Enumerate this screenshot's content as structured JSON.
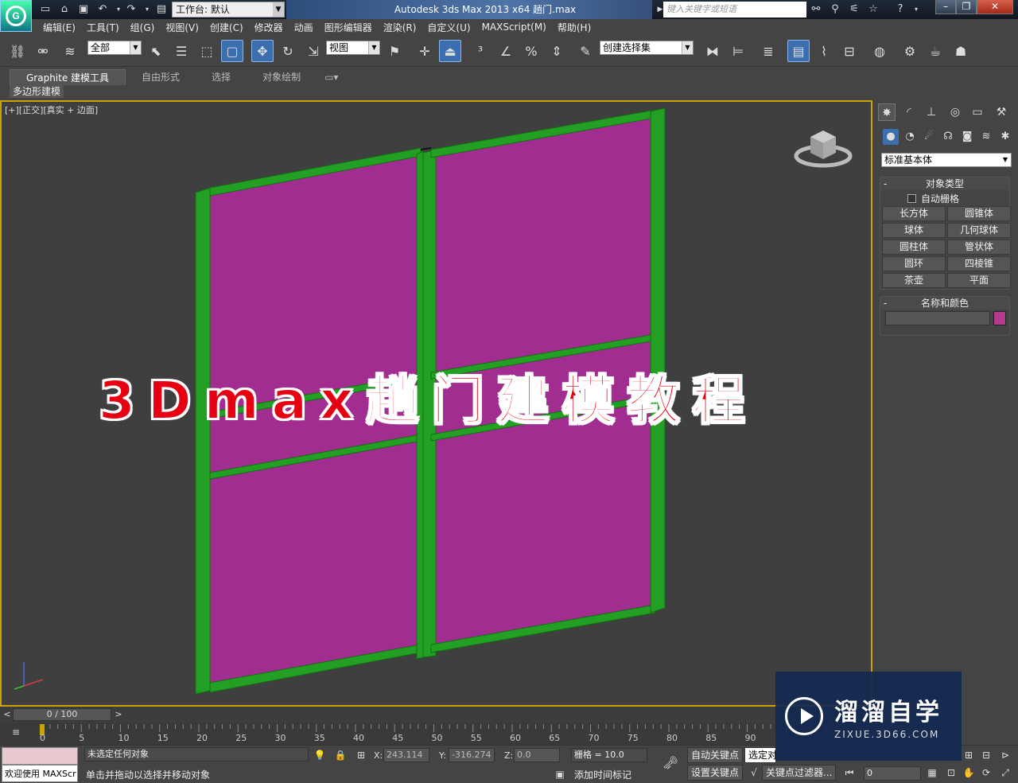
{
  "titlebar": {
    "workspace_label": "工作台: 默认",
    "app_title": "Autodesk 3ds Max  2013 x64      趟门.max",
    "search_placeholder": "键入关键字或短语"
  },
  "menu": [
    "编辑(E)",
    "工具(T)",
    "组(G)",
    "视图(V)",
    "创建(C)",
    "修改器",
    "动画",
    "图形编辑器",
    "渲染(R)",
    "自定义(U)",
    "MAXScript(M)",
    "帮助(H)"
  ],
  "toolbar": {
    "selection_filter": "全部",
    "ref_coord": "视图",
    "named_selection": "创建选择集"
  },
  "ribbon": {
    "tabs": [
      "Graphite 建模工具",
      "自由形式",
      "选择",
      "对象绘制"
    ],
    "sub_label": "多边形建模"
  },
  "viewport": {
    "label": "[+][正交][真实 + 边面]",
    "overlay_title": "3Dmax趟门建模教程"
  },
  "command_panel": {
    "category": "标准基本体",
    "object_type_title": "对象类型",
    "autogrid_label": "自动栅格",
    "objects": [
      "长方体",
      "圆锥体",
      "球体",
      "几何球体",
      "圆柱体",
      "管状体",
      "圆环",
      "四棱锥",
      "茶壶",
      "平面"
    ],
    "name_color_title": "名称和颜色",
    "object_color": "#b43a8c"
  },
  "timeline": {
    "frame_display": "0 / 100",
    "ticks": [
      "0",
      "5",
      "10",
      "15",
      "20",
      "25",
      "30",
      "35",
      "40",
      "45",
      "50",
      "55",
      "60",
      "65",
      "70",
      "75",
      "80",
      "85",
      "90"
    ]
  },
  "status": {
    "selection_status": "未选定任何对象",
    "prompt": "单击并拖动以选择并移动对象",
    "maxscript_welcome": "欢迎使用 MAXScr",
    "x_label": "X:",
    "x_value": "243.114",
    "y_label": "Y:",
    "y_value": "-316.274",
    "z_label": "Z:",
    "z_value": "0.0",
    "grid": "栅格 = 10.0",
    "add_time_tag": "添加时间标记",
    "auto_key": "自动关键点",
    "set_key": "设置关键点",
    "selected_dropdown": "选定对",
    "key_filters": "关键点过滤器...",
    "frame_field": "0"
  },
  "watermark": {
    "name": "溜溜自学",
    "url": "ZIXUE.3D66.COM"
  }
}
